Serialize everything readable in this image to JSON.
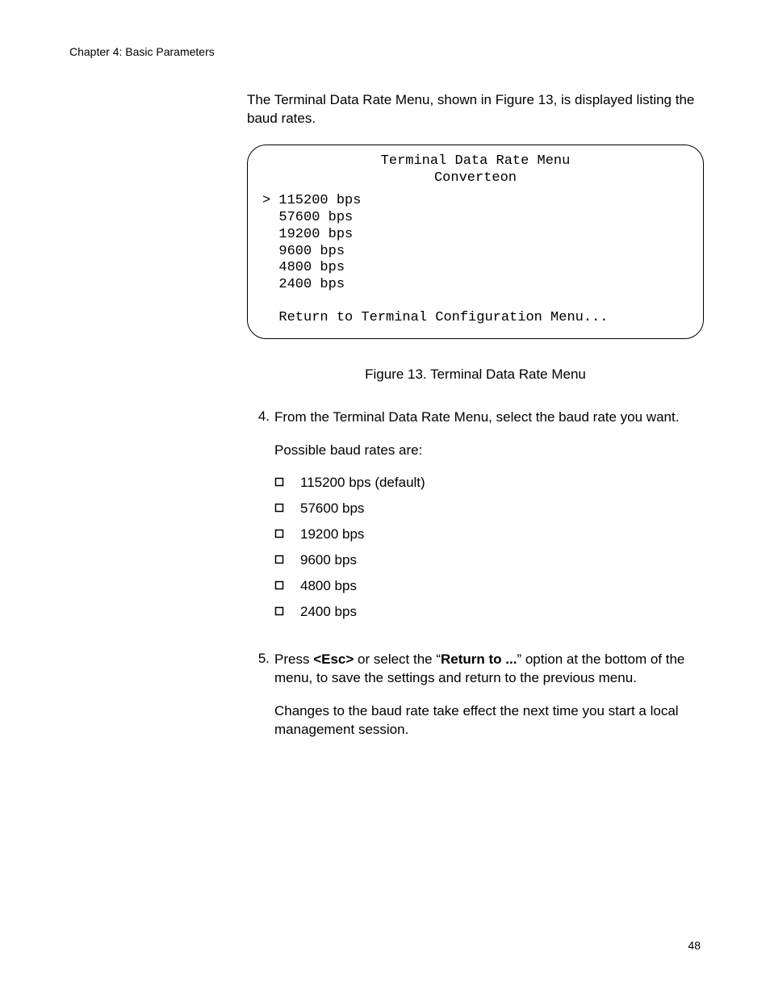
{
  "header": {
    "chapter_line": "Chapter 4: Basic Parameters"
  },
  "intro": {
    "paragraph": "The Terminal Data Rate Menu, shown in Figure 13, is displayed listing the baud rates."
  },
  "menu_box": {
    "title_line_1": "Terminal Data Rate Menu",
    "title_line_2": "Converteon",
    "cursor": ">",
    "items": [
      "115200 bps",
      "57600 bps",
      "19200 bps",
      "9600 bps",
      "4800 bps",
      "2400 bps"
    ],
    "return_line": "Return to Terminal Configuration Menu..."
  },
  "figure_caption": "Figure 13. Terminal Data Rate Menu",
  "step4": {
    "number": "4.",
    "line1": "From the Terminal Data Rate Menu, select the baud rate you want.",
    "line2": "Possible baud rates are:",
    "bullets": [
      "115200 bps (default)",
      "57600 bps",
      "19200 bps",
      "9600 bps",
      "4800 bps",
      "2400 bps"
    ]
  },
  "step5": {
    "number": "5.",
    "parts": {
      "p1a": "Press ",
      "p1b_bold": "<Esc>",
      "p1c": " or select the “",
      "p1d_bold": "Return to ...",
      "p1e": "” option at the bottom of the menu, to save the settings and return to the previous menu.",
      "p2": "Changes to the baud rate take effect the next time you start a local management session."
    }
  },
  "footer": {
    "page_number": "48"
  }
}
